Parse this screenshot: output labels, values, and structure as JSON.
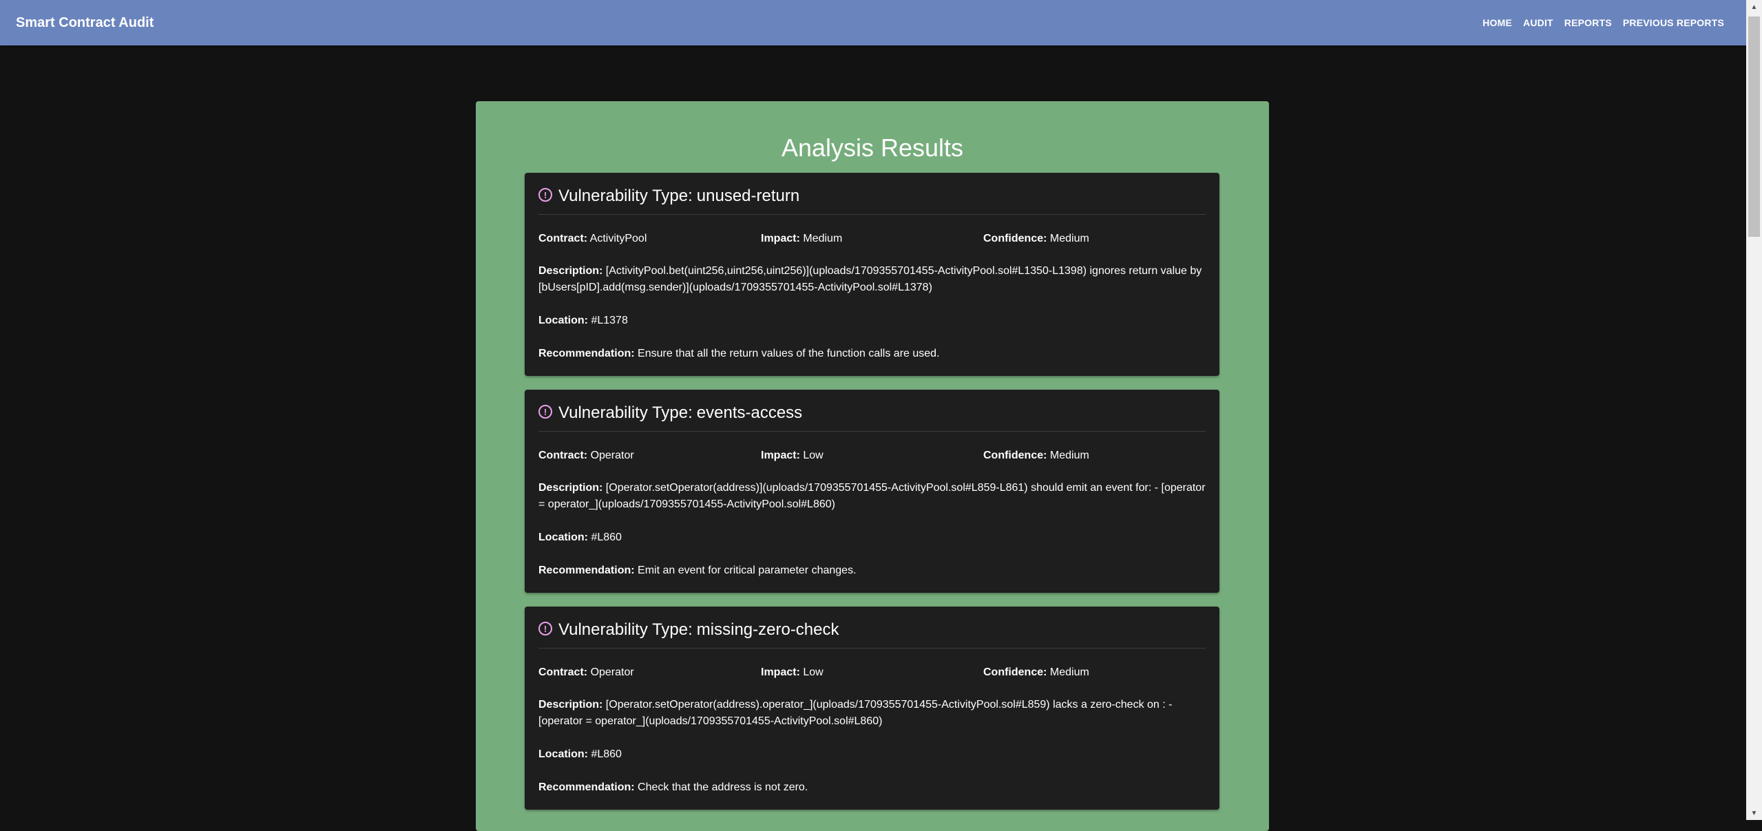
{
  "app": {
    "title": "Smart Contract Audit",
    "nav": [
      {
        "label": "HOME"
      },
      {
        "label": "AUDIT"
      },
      {
        "label": "REPORTS"
      },
      {
        "label": "PREVIOUS REPORTS"
      }
    ]
  },
  "labels": {
    "vuln_type": "Vulnerability Type:",
    "contract": "Contract:",
    "impact": "Impact:",
    "confidence": "Confidence:",
    "description": "Description:",
    "location": "Location:",
    "recommendation": "Recommendation:"
  },
  "panel": {
    "title": "Analysis Results"
  },
  "results": [
    {
      "type": "unused-return",
      "contract": "ActivityPool",
      "impact": "Medium",
      "confidence": "Medium",
      "description": "[ActivityPool.bet(uint256,uint256,uint256)](uploads/1709355701455-ActivityPool.sol#L1350-L1398) ignores return value by [bUsers[pID].add(msg.sender)](uploads/1709355701455-ActivityPool.sol#L1378)",
      "location": "#L1378",
      "recommendation": "Ensure that all the return values of the function calls are used."
    },
    {
      "type": "events-access",
      "contract": "Operator",
      "impact": "Low",
      "confidence": "Medium",
      "description": "[Operator.setOperator(address)](uploads/1709355701455-ActivityPool.sol#L859-L861) should emit an event for: - [operator = operator_](uploads/1709355701455-ActivityPool.sol#L860)",
      "location": "#L860",
      "recommendation": "Emit an event for critical parameter changes."
    },
    {
      "type": "missing-zero-check",
      "contract": "Operator",
      "impact": "Low",
      "confidence": "Medium",
      "description": "[Operator.setOperator(address).operator_](uploads/1709355701455-ActivityPool.sol#L859) lacks a zero-check on : - [operator = operator_](uploads/1709355701455-ActivityPool.sol#L860)",
      "location": "#L860",
      "recommendation": "Check that the address is not zero."
    }
  ],
  "icons": {
    "alert": "alert-circle-icon",
    "alert_color": "#e8a0e8"
  },
  "colors": {
    "appbar": "#6a84bd",
    "background": "#121212",
    "panel": "#76ad7c",
    "card": "#1e1e1e"
  }
}
